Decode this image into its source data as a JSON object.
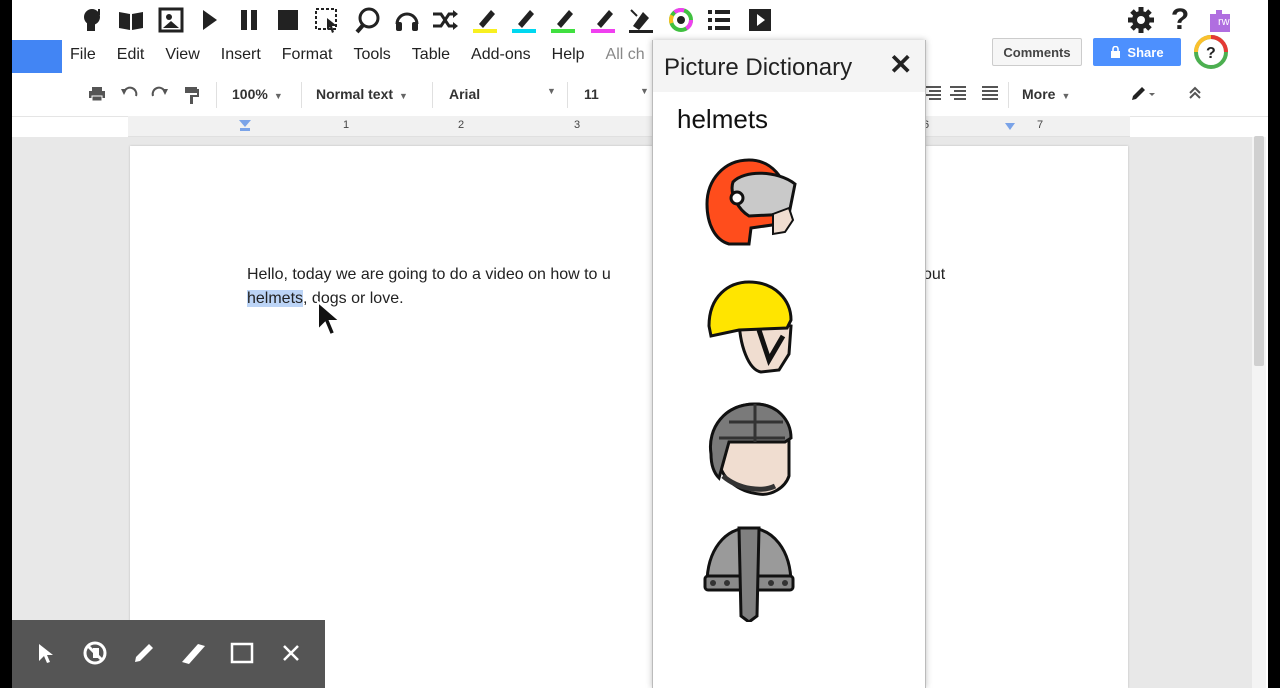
{
  "rw_toolbar": {
    "icons": [
      "speech-head-icon",
      "dictionary-icon",
      "picture-dictionary-icon",
      "play-icon",
      "pause-icon",
      "stop-icon",
      "screenshot-reader-icon",
      "audio-maker-icon",
      "headphones-icon",
      "translator-icon",
      "highlight-yellow-icon",
      "highlight-blue-icon",
      "highlight-green-icon",
      "highlight-pink-icon",
      "clear-highlights-icon",
      "collect-highlights-icon",
      "vocabulary-list-icon",
      "voice-note-icon"
    ],
    "settings_icon": "gear-icon",
    "help_icon": "help-icon",
    "rw_label": "rw"
  },
  "menu": {
    "items": [
      "File",
      "Edit",
      "View",
      "Insert",
      "Format",
      "Tools",
      "Table",
      "Add-ons",
      "Help"
    ],
    "status": "All ch"
  },
  "header": {
    "comments_label": "Comments",
    "share_label": "Share"
  },
  "format_toolbar": {
    "zoom": "100%",
    "style": "Normal text",
    "font": "Arial",
    "size": "11",
    "more_label": "More"
  },
  "ruler": {
    "numbers": [
      "1",
      "2",
      "3",
      "6",
      "7"
    ]
  },
  "document": {
    "line1_part1": "Hello, today we are going to do a video on how to u",
    "line1_part2": "out",
    "line2_highlight": "helmets",
    "line2_rest": ", dogs or love."
  },
  "picture_dictionary": {
    "title": "Picture Dictionary",
    "close_symbol": "✕",
    "word": "helmets",
    "images": [
      "motorcycle-helmet",
      "bicycle-helmet",
      "rugby-scrum-cap",
      "viking-helmet"
    ]
  },
  "annotation_toolbar": {
    "tools": [
      "pointer-icon",
      "eraser-icon",
      "pen-icon",
      "highlighter-icon",
      "rectangle-icon",
      "close-icon"
    ]
  },
  "colors": {
    "docs_blue": "#4285f4",
    "share_blue": "#4d90fe",
    "selection": "#bcd4f6",
    "highlight_yellow": "#f8f020",
    "highlight_blue": "#00d8f0",
    "highlight_green": "#40e040",
    "highlight_pink": "#f040f0"
  }
}
